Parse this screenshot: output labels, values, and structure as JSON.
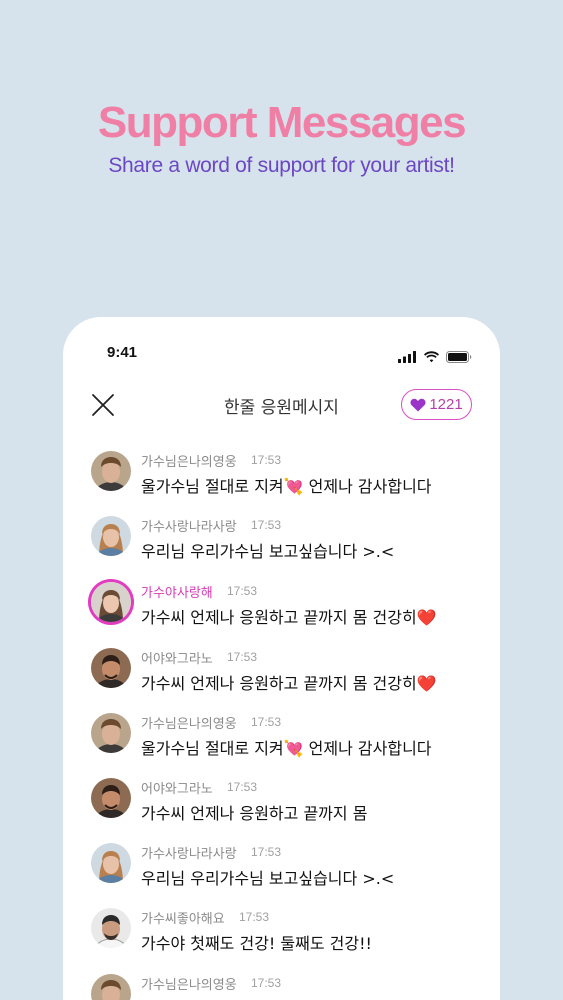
{
  "promo": {
    "title": "Support Messages",
    "subtitle": "Share a word of support for your artist!"
  },
  "status_bar": {
    "time": "9:41",
    "icons": [
      "signal-icon",
      "wifi-icon",
      "battery-icon"
    ]
  },
  "header": {
    "close_icon": "close-icon",
    "title": "한줄 응원메시지",
    "heart_count": "1221",
    "heart_icon": "heart-icon"
  },
  "colors": {
    "background": "#d6e3ed",
    "promo_title": "#f07fa6",
    "promo_subtitle": "#6c47c4",
    "accent": "#d94fc4"
  },
  "messages": [
    {
      "name": "가수님은나의영웅",
      "time": "17:53",
      "text": "울가수님 절대로 지켜💘 언제나 감사합니다",
      "avatar": "avatar-man-1",
      "highlighted": false
    },
    {
      "name": "가수사랑나라사랑",
      "time": "17:53",
      "text": "우리님 우리가수님 보고싶습니다 >.<",
      "avatar": "avatar-woman-1",
      "highlighted": false
    },
    {
      "name": "가수야사랑해",
      "time": "17:53",
      "text": "가수씨 언제나 응원하고 끝까지 몸 건강히❤️",
      "avatar": "avatar-woman-2",
      "highlighted": true
    },
    {
      "name": "어야와그라노",
      "time": "17:53",
      "text": "가수씨 언제나 응원하고 끝까지 몸 건강히❤️",
      "avatar": "avatar-man-2",
      "highlighted": false
    },
    {
      "name": "가수님은나의영웅",
      "time": "17:53",
      "text": "울가수님 절대로 지켜💘 언제나 감사합니다",
      "avatar": "avatar-man-1",
      "highlighted": false
    },
    {
      "name": "어야와그라노",
      "time": "17:53",
      "text": "가수씨 언제나 응원하고 끝까지 몸",
      "avatar": "avatar-man-2",
      "highlighted": false
    },
    {
      "name": "가수사랑나라사랑",
      "time": "17:53",
      "text": "우리님 우리가수님 보고싶습니다 >.<",
      "avatar": "avatar-woman-1",
      "highlighted": false
    },
    {
      "name": "가수씨좋아해요",
      "time": "17:53",
      "text": "가수야 첫째도 건강! 둘째도 건강!!",
      "avatar": "avatar-man-3",
      "highlighted": false
    },
    {
      "name": "가수님은나의영웅",
      "time": "17:53",
      "text": "",
      "avatar": "avatar-man-1",
      "highlighted": false
    }
  ]
}
